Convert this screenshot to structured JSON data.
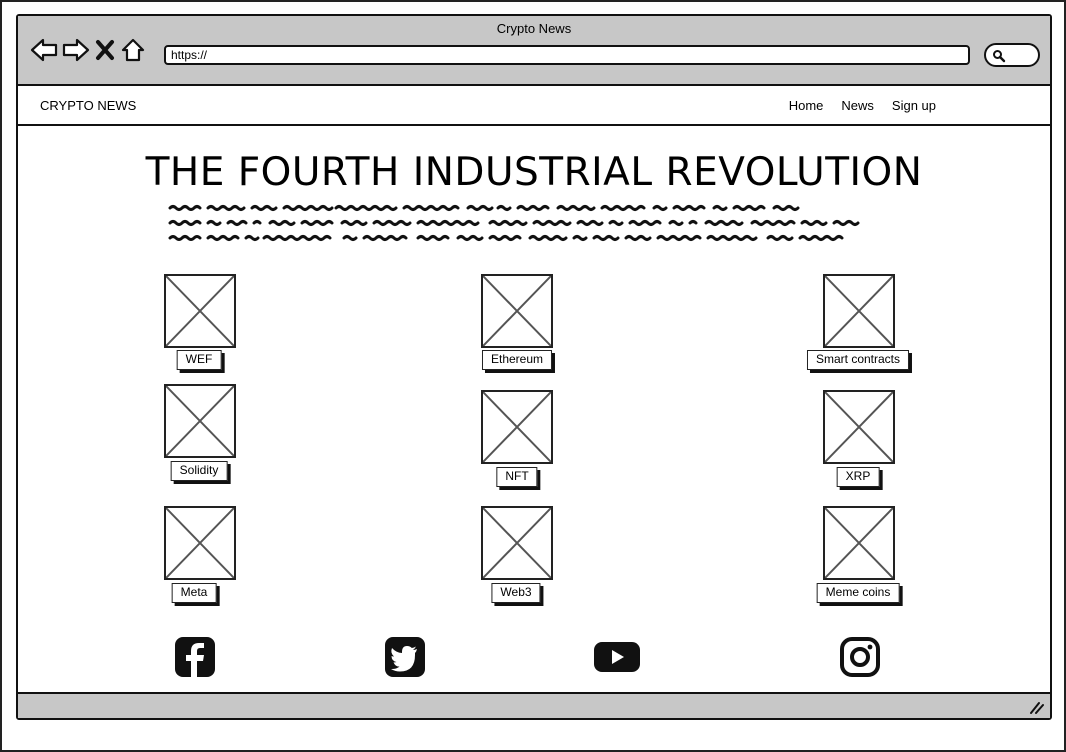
{
  "window": {
    "title": "Crypto News"
  },
  "address_bar": {
    "value": "https://"
  },
  "header": {
    "brand": "CRYPTO NEWS",
    "nav": [
      "Home",
      "News",
      "Sign up"
    ]
  },
  "hero": {
    "title": "THE FOURTH INDUSTRIAL REVOLUTION"
  },
  "tiles": [
    "WEF",
    "Ethereum",
    "Smart contracts",
    "Solidity",
    "NFT",
    "XRP",
    "Meta",
    "Web3",
    "Meme coins"
  ],
  "social": [
    "facebook-icon",
    "twitter-icon",
    "youtube-icon",
    "instagram-icon"
  ],
  "colors": {
    "chrome": "#c7c7c7",
    "ink": "#111111",
    "background": "#ffffff"
  }
}
